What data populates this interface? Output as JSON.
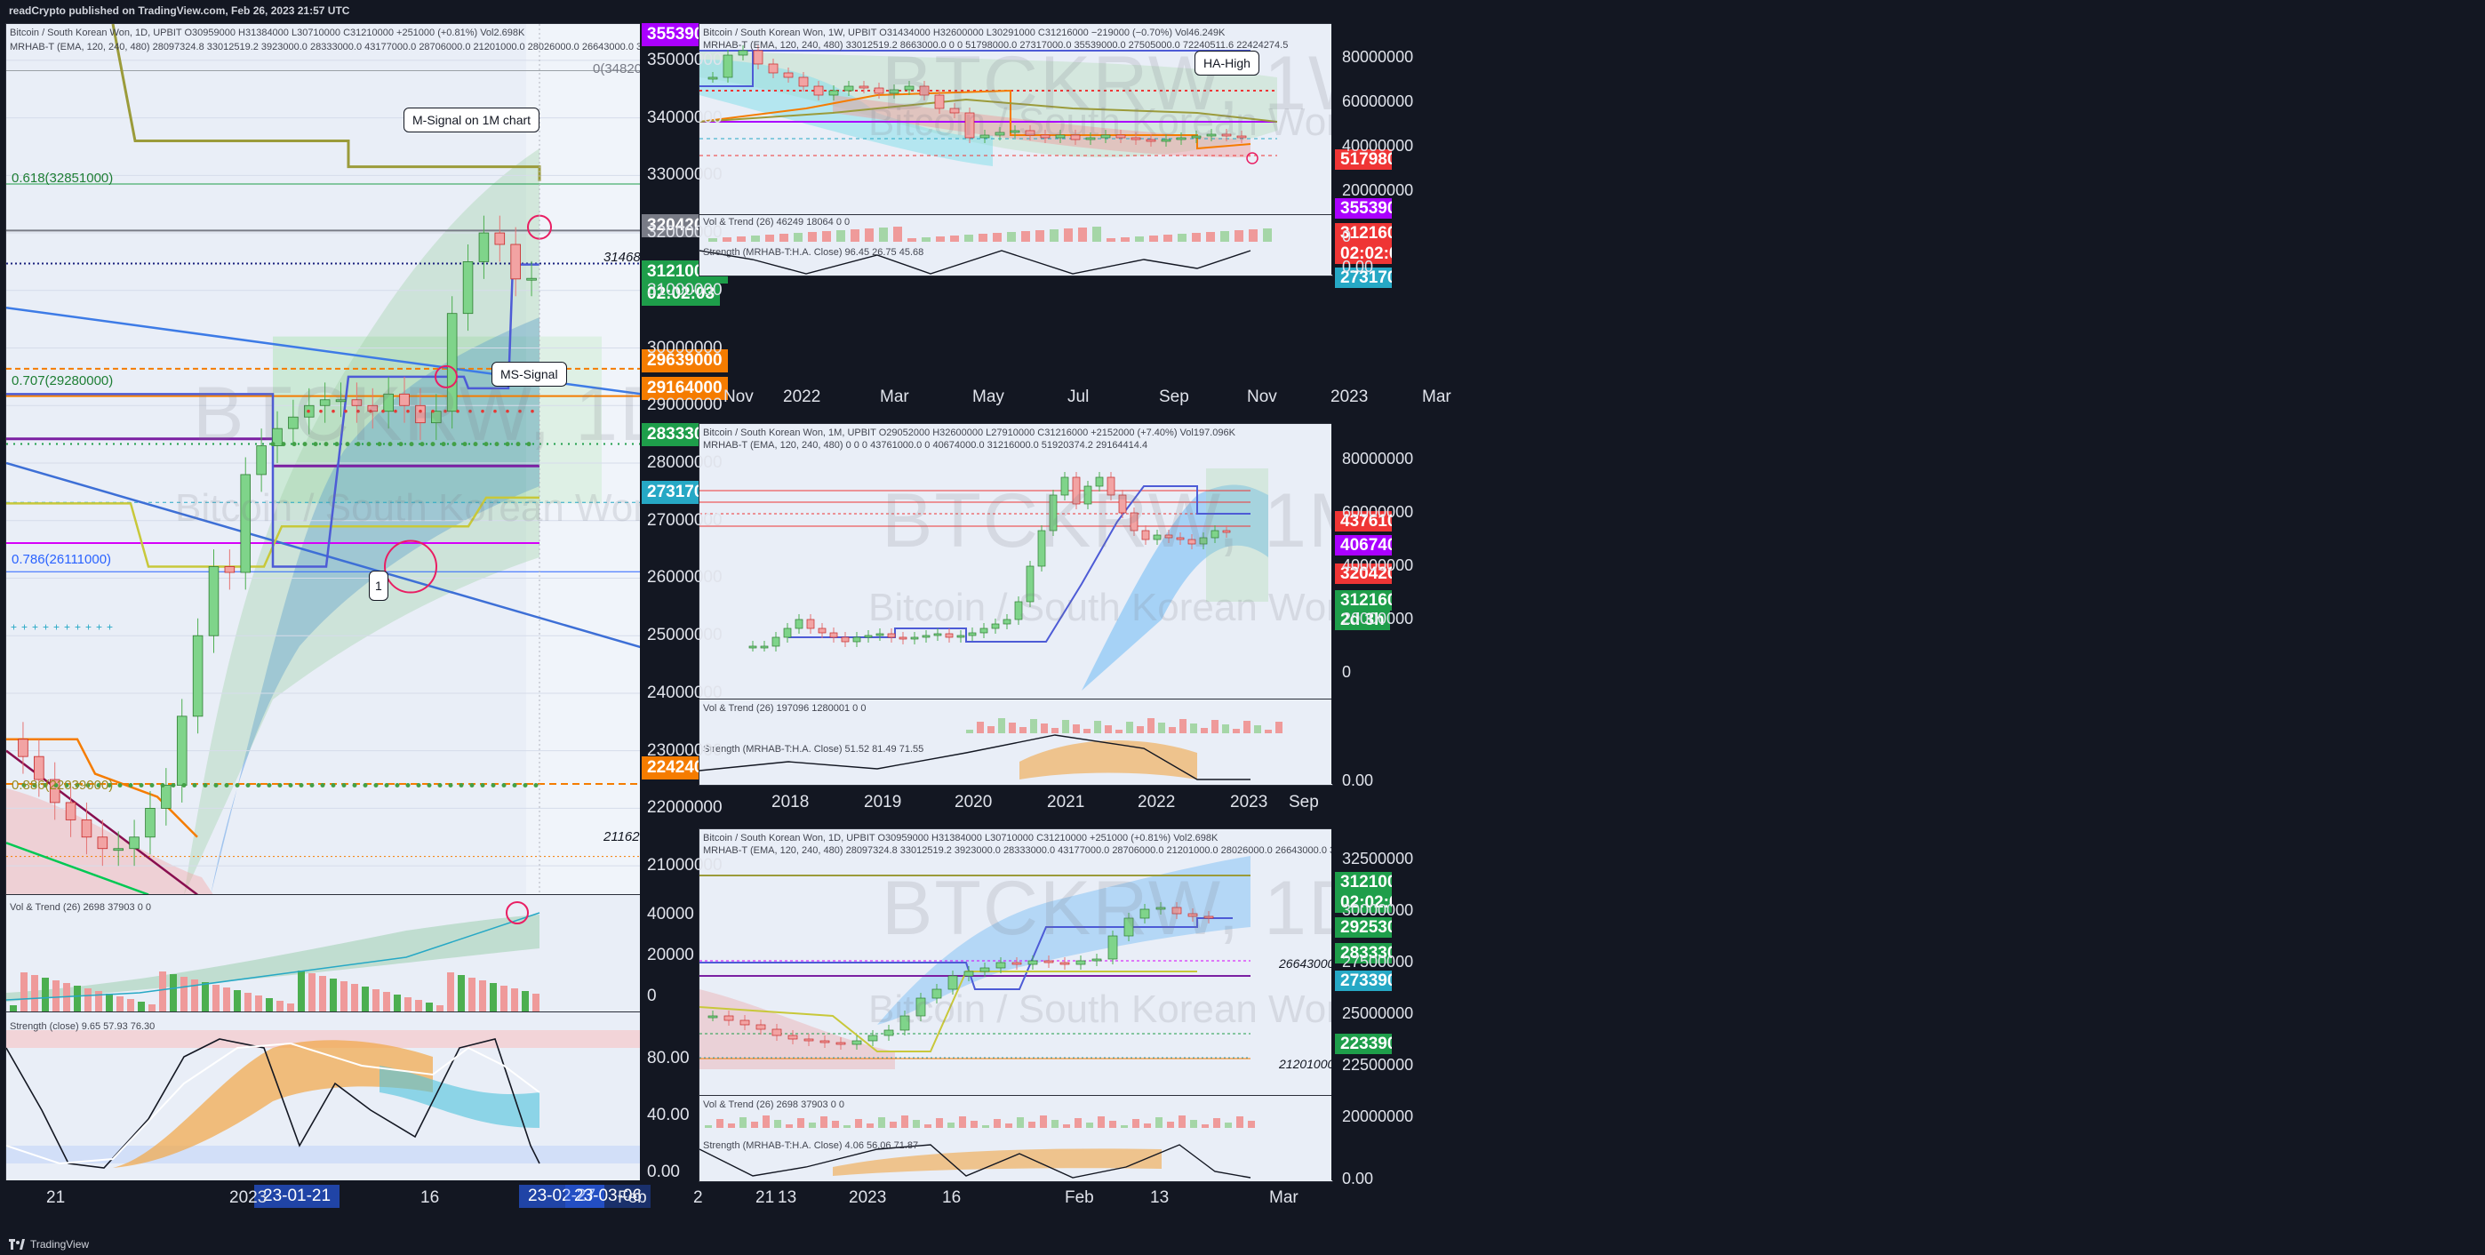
{
  "header": {
    "published": "readCrypto published on TradingView.com, Feb 26, 2023 21:57 UTC"
  },
  "footer": {
    "brand": "TradingView"
  },
  "colors": {
    "bg": "#131722",
    "pane": "#e9eef7",
    "purple": "#aa00ff",
    "gray": "#787b86",
    "green": "#1e9e4a",
    "orange": "#f57c00",
    "teal": "#26a8c5",
    "red": "#ef3535",
    "blue": "#2962ff"
  },
  "main": {
    "legend1": "Bitcoin / South Korean Won, 1D, UPBIT  O30959000 H31384000 L30710000 C31210000 +251000 (+0.81%)  Vol2.698K",
    "legend2": "MRHAB-T (EMA, 120, 240, 480)  28097324.8  33012519.2  3923000.0  28333000.0  43177000.0  28706000.0  21201000.0  28026000.0  26643000.0  31467556.1  21162315.0",
    "watermark": "BTCKRW, 1D",
    "watermark2": "Bitcoin / South Korean Won",
    "fib": [
      {
        "label": "0(34820000)",
        "kind": "fib0"
      },
      {
        "label": "0.618(32851000)"
      },
      {
        "label": "0.707(29280000)"
      },
      {
        "label": "0.786(26111000)"
      },
      {
        "label": "0.886(22039000)"
      }
    ],
    "callout_msignal_1m": "M-Signal on 1M chart",
    "callout_mssignal": "MS-Signal",
    "callout_1": "1",
    "price_31468000": "31468000",
    "price_21162000": "21162000",
    "axis_ticks": [
      "35000000",
      "34000000",
      "33000000",
      "32000000",
      "31000000",
      "30000000",
      "29000000",
      "28000000",
      "27000000",
      "26000000",
      "25000000",
      "24000000",
      "23000000",
      "22000000",
      "21000000"
    ],
    "tags": {
      "t35539000": "35539000",
      "t32042000": "32042000",
      "t31210000": "31210000",
      "t_countdown": "02:02:03",
      "t29639000": "29639000",
      "t29164000": "29164000",
      "t28333000": "28333000",
      "t27317000": "27317000",
      "t22424000": "22424000"
    },
    "vol_legend": "Vol & Trend (26)  2698  37903  0  0",
    "vol_ticks": [
      "40000",
      "20000",
      "0"
    ],
    "str_legend": "Strength (close)  9.65  57.93  76.30",
    "str_ticks": [
      "80.00",
      "40.00",
      "0.00"
    ],
    "x_ticks": [
      "21",
      "2023",
      "16",
      "Feb",
      "13"
    ],
    "x_hl": [
      "23-01-21",
      "23-02-27",
      "23-03-06"
    ]
  },
  "w1": {
    "legend1": "Bitcoin / South Korean Won, 1W, UPBIT  O31434000 H32600000 L30291000 C31216000 −219000 (−0.70%)  Vol46.249K",
    "legend2": "MRHAB-T (EMA, 120, 240, 480)  33012519.2  8663000.0  0  0  51798000.0  27317000.0  35539000.0  27505000.0  72240511.6  22424274.5",
    "watermark": "BTCKRW, 1W",
    "watermark2": "Bitcoin / South Korean Won",
    "callout_hahigh": "HA-High",
    "axis_ticks": [
      "80000000",
      "60000000",
      "40000000",
      "20000000"
    ],
    "tags": {
      "t51798000": "51798000",
      "t35539000": "35539000",
      "t31216000": "31216000",
      "t_countdown": "02:02:03",
      "t27317000": "27317000"
    },
    "vol_legend": "Vol & Trend (26)  46249  18064  0  0",
    "vol_tick": "0",
    "str_legend": "Strength (MRHAB-T:H.A. Close)  96.45  26.75  45.68",
    "str_tick": "0.00",
    "x_ticks": [
      "Nov",
      "2022",
      "Mar",
      "May",
      "Jul",
      "Sep",
      "Nov",
      "2023",
      "Mar"
    ]
  },
  "m1": {
    "legend1": "Bitcoin / South Korean Won, 1M, UPBIT  O29052000 H32600000 L27910000 C31216000 +2152000 (+7.40%)  Vol197.096K",
    "legend2": "MRHAB-T (EMA, 120, 240, 480)  0  0  0  43761000.0  0  40674000.0  31216000.0  51920374.2  29164414.4",
    "watermark": "BTCKRW, 1M",
    "watermark2": "Bitcoin / South Korean Won",
    "axis_ticks": [
      "80000000",
      "60000000",
      "40000000",
      "20000000",
      "0"
    ],
    "tags": {
      "t43761000": "43761000",
      "t40674000": "40674000",
      "t32042000": "32042000",
      "t31216000": "31216000",
      "t_countdown": "2d 3h"
    },
    "vol_legend": "Vol & Trend (26)  197096  1280001  0  0",
    "str_legend": "Strength (MRHAB-T:H.A. Close)  51.52  81.49  71.55",
    "str_tick": "0.00",
    "x_ticks": [
      "2018",
      "2019",
      "2020",
      "2021",
      "2022",
      "2023",
      "Sep"
    ]
  },
  "d1": {
    "legend1": "Bitcoin / South Korean Won, 1D, UPBIT  O30959000 H31384000 L30710000 C31210000 +251000 (+0.81%)  Vol2.698K",
    "legend2": "MRHAB-T (EMA, 120, 240, 480)  28097324.8  33012519.2  3923000.0  28333000.0  43177000.0  28706000.0  21201000.0  28026000.0  26643000.0  31467556.1  21162315.0",
    "watermark": "BTCKRW, 1D",
    "watermark2": "Bitcoin / South Korean Won",
    "price_26643000": "26643000",
    "price_21201000": "21201000",
    "axis_ticks": [
      "32500000",
      "30000000",
      "27500000",
      "25000000",
      "22500000",
      "20000000"
    ],
    "tags": {
      "t31210000": "31210000",
      "t_countdown": "02:02:03",
      "t29253000": "29253000",
      "t28333000": "28333000",
      "t27339000": "27339000",
      "t22339000": "22339000"
    },
    "vol_legend": "Vol & Trend (26)  2698  37903  0  0",
    "str_legend": "Strength (MRHAB-T:H.A. Close)  4.06  56.06  71.87",
    "str_tick": "0.00",
    "x_ticks": [
      "2",
      "21",
      "2023",
      "16",
      "Feb",
      "13",
      "Mar"
    ]
  },
  "chart_data": [
    {
      "type": "candlestick",
      "title": "Bitcoin / South Korean Won, 1D, UPBIT",
      "ylim": [
        20400000,
        35600000
      ],
      "current_close": 31210000,
      "closes_approx": [
        22900000,
        22500000,
        22100000,
        21800000,
        21500000,
        21300000,
        21300000,
        21500000,
        22000000,
        22400000,
        23600000,
        25000000,
        26200000,
        26100000,
        27800000,
        28300000,
        28600000,
        28800000,
        29000000,
        29100000,
        29100000,
        29000000,
        28900000,
        29200000,
        29000000,
        28700000,
        28900000,
        30600000,
        31500000,
        32000000,
        31800000,
        31200000,
        31210000
      ]
    },
    {
      "type": "candlestick",
      "title": "Bitcoin / South Korean Won, 1W, UPBIT",
      "ylim": [
        0,
        85000000
      ],
      "current_close": 31216000
    },
    {
      "type": "candlestick",
      "title": "Bitcoin / South Korean Won, 1M, UPBIT",
      "ylim": [
        0,
        85000000
      ],
      "current_close": 31216000
    },
    {
      "type": "candlestick",
      "title": "Bitcoin / South Korean Won, 1D, UPBIT",
      "ylim": [
        19500000,
        33200000
      ],
      "current_close": 31210000
    }
  ]
}
